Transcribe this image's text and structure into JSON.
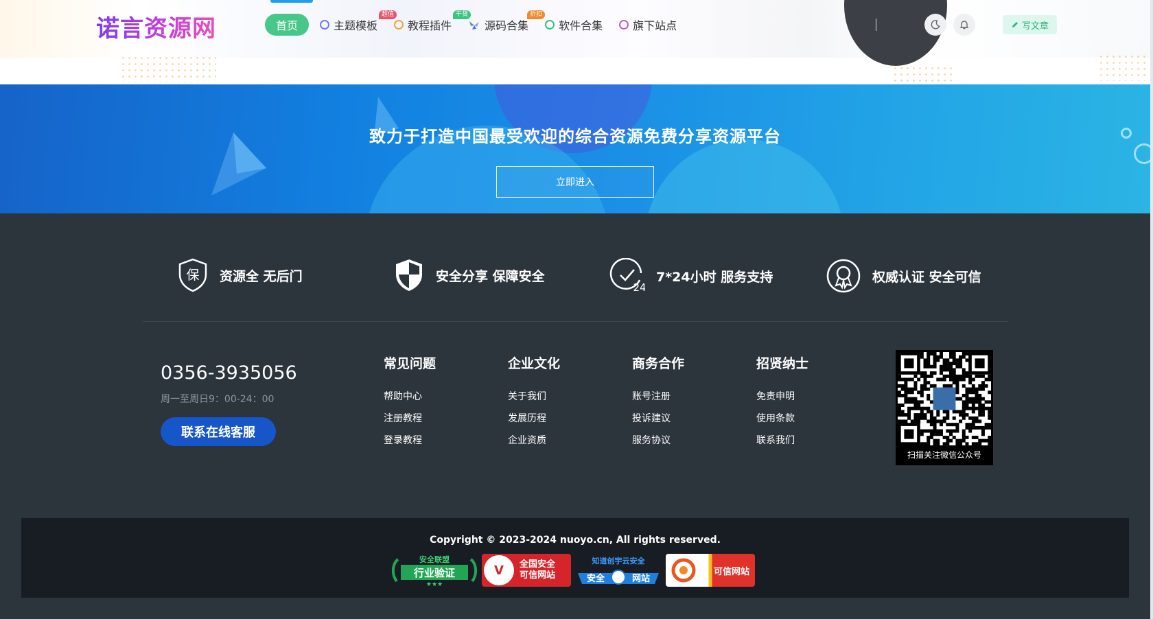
{
  "header": {
    "logo": "诺言资源网",
    "nav": [
      {
        "label": "首页",
        "badge": ""
      },
      {
        "label": "主题模板",
        "badge": "超值"
      },
      {
        "label": "教程插件",
        "badge": "干货"
      },
      {
        "label": "源码合集",
        "badge": "折扣"
      },
      {
        "label": "软件合集",
        "badge": ""
      },
      {
        "label": "旗下站点",
        "badge": ""
      }
    ],
    "write_label": "写文章",
    "colors": {
      "home_bg": "#47c78a",
      "badge_red": "#e9546b",
      "badge_green": "#3dc483",
      "badge_orange": "#f08a24"
    }
  },
  "banner": {
    "title": "致力于打造中国最受欢迎的综合资源免费分享资源平台",
    "button": "立即进入"
  },
  "features": [
    {
      "label": "资源全 无后门",
      "icon": "shield-bao-icon",
      "glyph": "保"
    },
    {
      "label": "安全分享 保障安全",
      "icon": "shield-half-icon"
    },
    {
      "label": "7*24小时 服务支持",
      "icon": "clock-24-icon",
      "glyph": "24"
    },
    {
      "label": "权威认证 安全可信",
      "icon": "award-badge-icon"
    }
  ],
  "contact": {
    "phone": "0356-3935056",
    "hours": "周一至周日9：00-24：00",
    "service_button": "联系在线客服"
  },
  "columns": [
    {
      "title": "常见问题",
      "links": [
        "帮助中心",
        "注册教程",
        "登录教程"
      ]
    },
    {
      "title": "企业文化",
      "links": [
        "关于我们",
        "发展历程",
        "企业资质"
      ]
    },
    {
      "title": "商务合作",
      "links": [
        "账号注册",
        "投诉建议",
        "服务协议"
      ]
    },
    {
      "title": "招贤纳士",
      "links": [
        "免责申明",
        "使用条款",
        "联系我们"
      ]
    }
  ],
  "qr": {
    "caption": "扫描关注微信公众号"
  },
  "footer": {
    "copyright": "Copyright © 2023-2024 nuoyo.cn, All rights reserved.",
    "certs": [
      {
        "top": "安全联盟",
        "main": "行业验证",
        "color": "#22a655"
      },
      {
        "main": "全国安全\n可信网站",
        "color": "#d5252a"
      },
      {
        "top": "知道创宇云安全",
        "left": "安全",
        "right": "网站",
        "color": "#1e7fe0"
      },
      {
        "main": "可信网站",
        "color": "#e0322b"
      }
    ]
  }
}
